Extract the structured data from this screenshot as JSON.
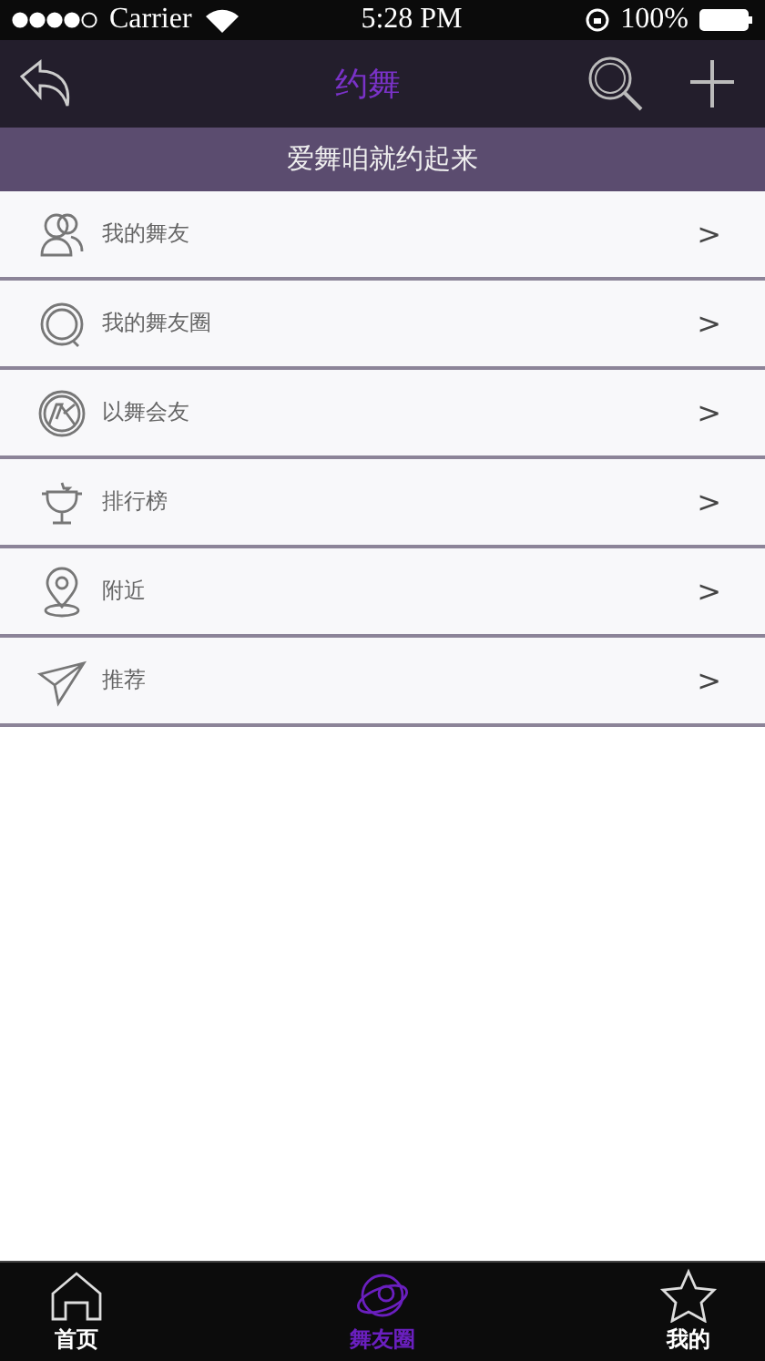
{
  "status_bar": {
    "carrier": "Carrier",
    "time": "5:28 PM",
    "battery": "100%"
  },
  "nav": {
    "title": "约舞"
  },
  "banner": "爱舞咱就约起来",
  "menu": [
    {
      "kind": "friends",
      "label": "我的舞友",
      "chevron": ">"
    },
    {
      "kind": "circle",
      "label": "我的舞友圈",
      "chevron": ">"
    },
    {
      "kind": "pk",
      "label": "以舞会友",
      "chevron": ">"
    },
    {
      "kind": "trophy",
      "label": "排行榜",
      "chevron": ">"
    },
    {
      "kind": "location",
      "label": "附近",
      "chevron": ">"
    },
    {
      "kind": "plane",
      "label": "推荐",
      "chevron": ">"
    }
  ],
  "tab_bar": [
    {
      "kind": "home",
      "label": "首页",
      "selected": false
    },
    {
      "kind": "planet",
      "label": "舞友圈",
      "selected": true
    },
    {
      "kind": "star",
      "label": "我的",
      "selected": false
    }
  ]
}
